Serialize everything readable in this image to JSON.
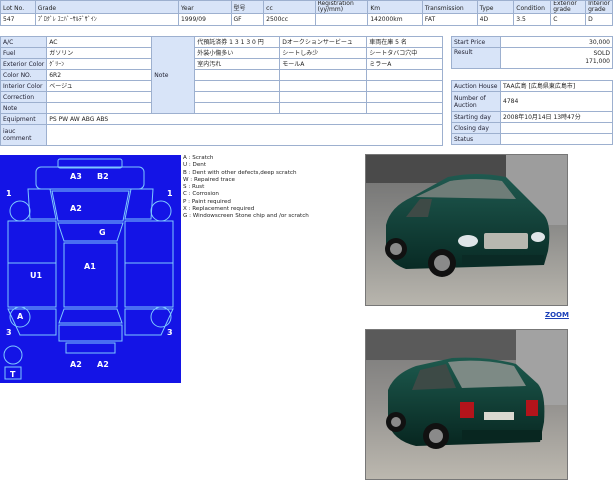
{
  "top": {
    "headers": [
      "Lot No.",
      "Grade",
      "Year",
      "型号",
      "cc",
      "Registration (yy/mm)",
      "Km",
      "Transmission",
      "Type",
      "Condition",
      "Exterior grade",
      "Interior grade"
    ],
    "values": [
      "547",
      "ﾌﾟﾛｸﾞﾚ ﾕﾆﾊﾞｰｻﾙﾃﾞｻﾞｲﾝ",
      "1999/09",
      "GF",
      "2500cc",
      "",
      "142000km",
      "FAT",
      "4D",
      "3.5",
      "C",
      "D"
    ]
  },
  "spec": {
    "labels": [
      "A/C",
      "Fuel",
      "Exterior Color",
      "Color NO.",
      "Interior Color",
      "Correction",
      "Note",
      "Equipment",
      "iauc comment"
    ],
    "values": [
      "AC",
      "ガソリン",
      "ｸﾞﾘｰﾝ",
      "6R2",
      "ベージュ",
      "",
      "",
      "PS PW AW ABG ABS",
      ""
    ],
    "note_label": "Note",
    "notes": [
      [
        "代預託済券 1 3 1 3 0 円",
        "Dオークションサービーュ",
        "車両在庫 5 名"
      ],
      [
        "外装小傷多い",
        "シートしみ少",
        "シートタバコ穴中"
      ],
      [
        "室内汚れ",
        "モールA",
        "ミラーA"
      ]
    ]
  },
  "price": {
    "start_label": "Start Price",
    "start_value": "30,000",
    "result_label": "Result",
    "result_status": "SOLD",
    "result_value": "171,000"
  },
  "auction": {
    "rows": [
      {
        "label": "Auction House",
        "value": "TAA広島 [広島県東広島市]"
      },
      {
        "label": "Number of Auction",
        "value": "4784"
      },
      {
        "label": "Starting day",
        "value": "2008年10月14日 13時47分"
      },
      {
        "label": "Closing day",
        "value": ""
      },
      {
        "label": "Status",
        "value": ""
      }
    ]
  },
  "sheet": {
    "marks": [
      "A3",
      "B2",
      "1",
      "1",
      "A2",
      "G",
      "A1",
      "U1",
      "A",
      "3",
      "3",
      "A2",
      "A2",
      "T"
    ],
    "bg_color": "#1414e6"
  },
  "legend": [
    "A : Scratch",
    "U : Dent",
    "B : Dent with other defects,deep scratch",
    "W : Repaired trace",
    "S : Rust",
    "C : Corrosion",
    "P : Paint required",
    "X : Replacement required",
    "G : Windowscreen Stone chip and /or scratch"
  ],
  "zoom_label": "ZOOM"
}
